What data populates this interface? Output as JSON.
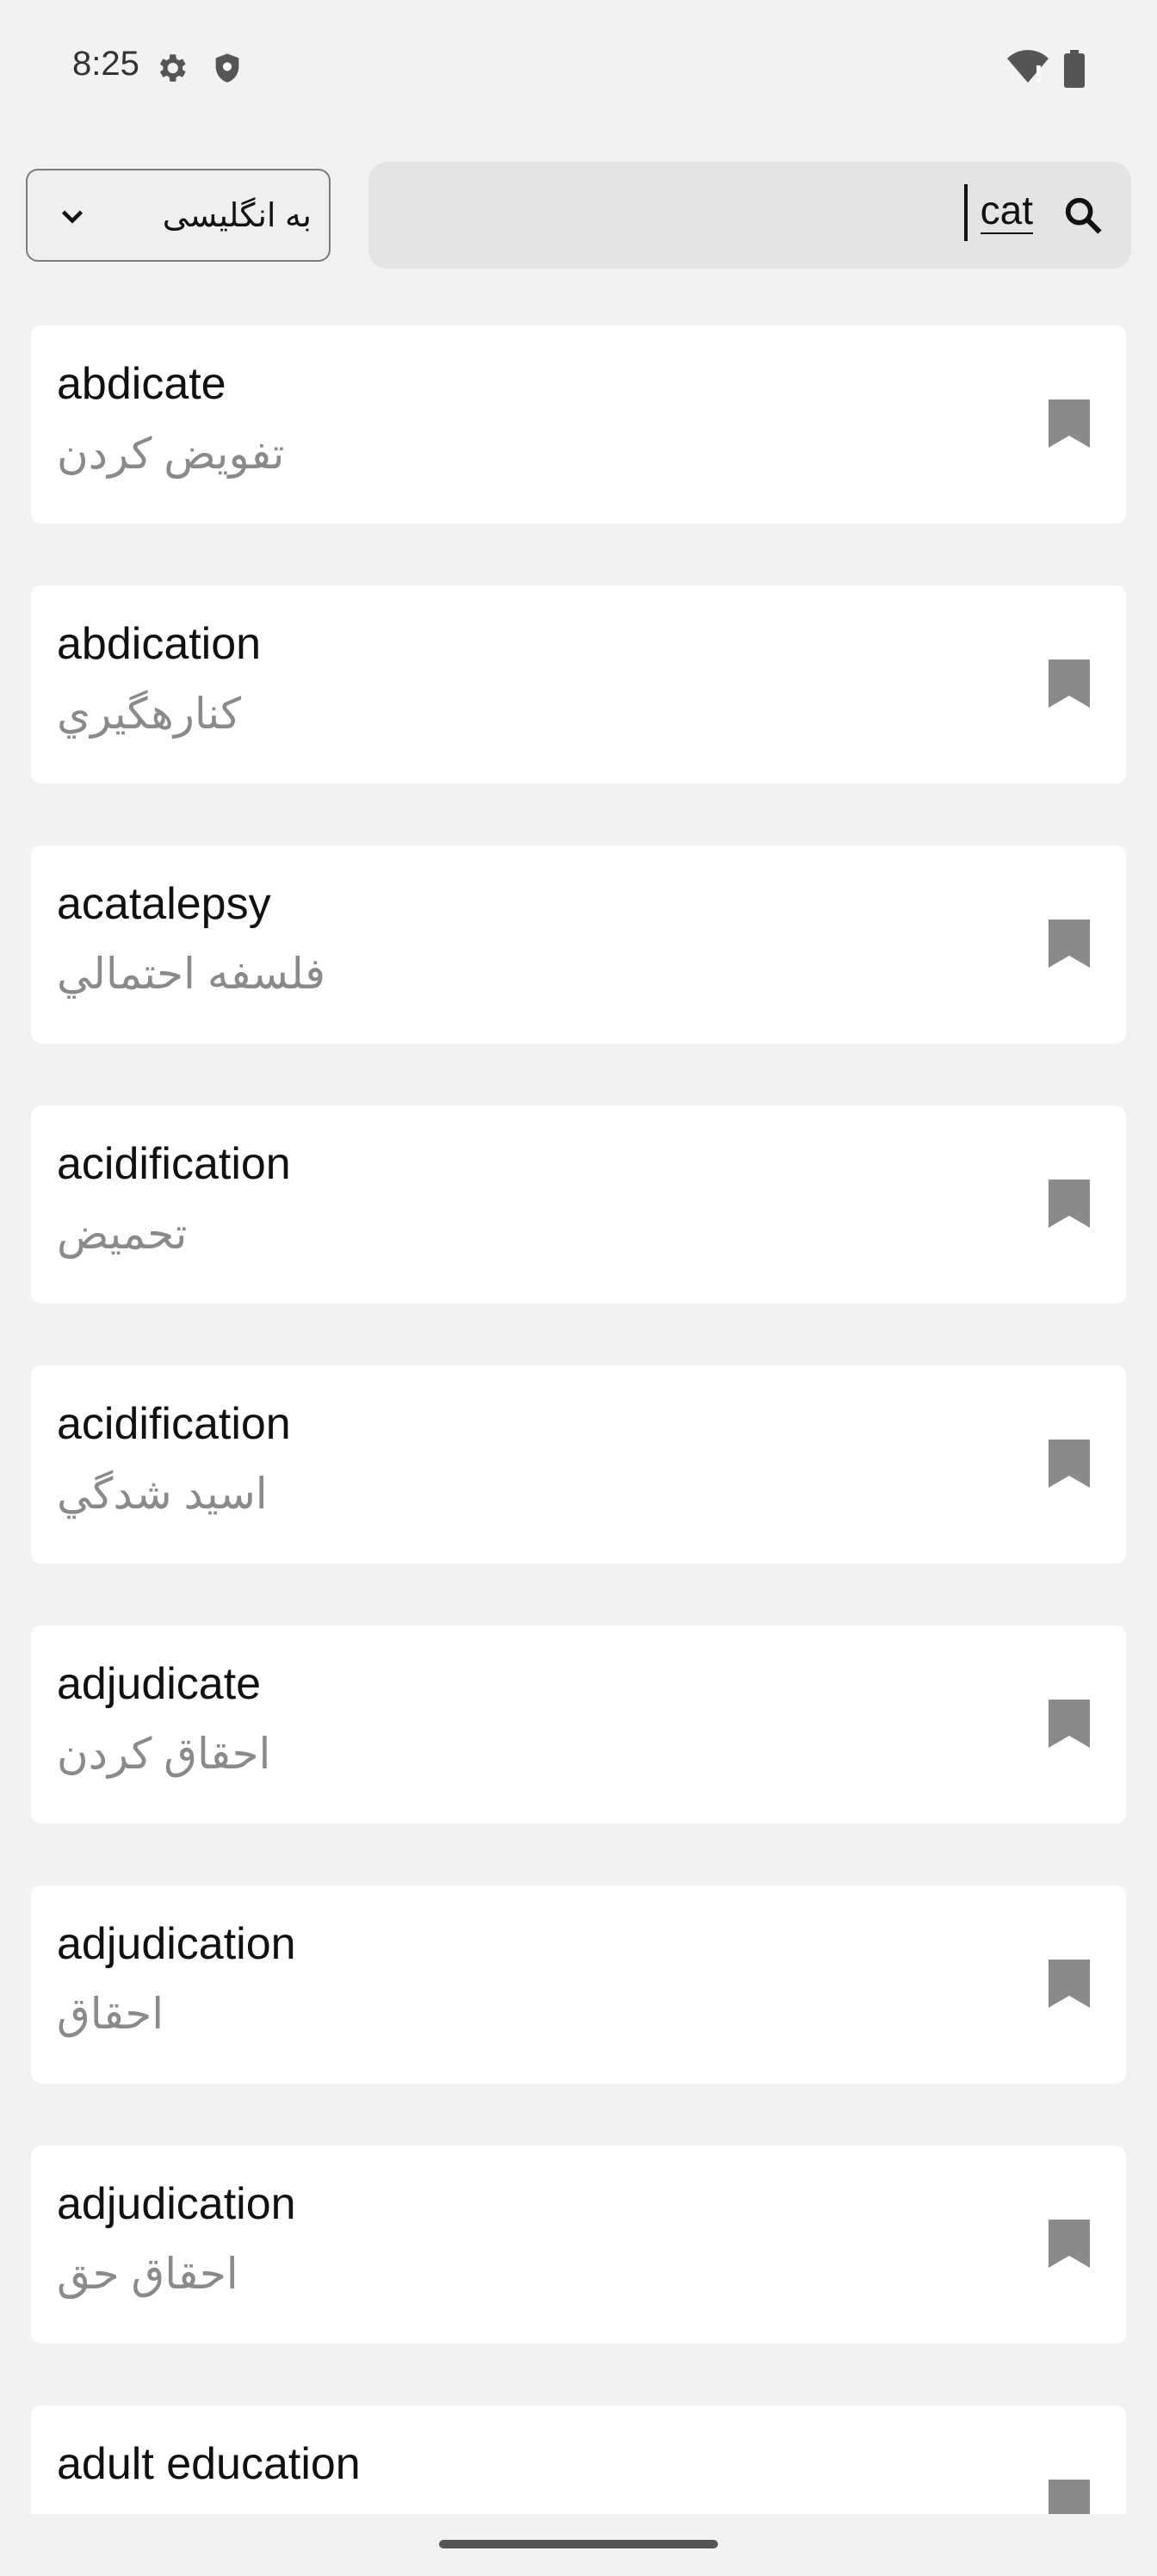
{
  "status_bar": {
    "time": "8:25",
    "left_icons": [
      "settings-icon",
      "shield-icon"
    ],
    "right_icons": [
      "wifi-icon",
      "battery-icon"
    ]
  },
  "language_select": {
    "selected": "به انگلیسی",
    "icon": "chevron-down-icon"
  },
  "search": {
    "value": "cat",
    "icon": "search-icon"
  },
  "results": [
    {
      "word": "abdicate",
      "meaning": "تفويض كردن"
    },
    {
      "word": "abdication",
      "meaning": "كنارهگيري"
    },
    {
      "word": "acatalepsy",
      "meaning": "فلسفه احتمالي"
    },
    {
      "word": "acidification",
      "meaning": "تحميض"
    },
    {
      "word": "acidification",
      "meaning": "اسيد شدگي"
    },
    {
      "word": "adjudicate",
      "meaning": "احقاق كردن"
    },
    {
      "word": "adjudication",
      "meaning": "احقاق"
    },
    {
      "word": "adjudication",
      "meaning": "احقاق حق"
    },
    {
      "word": "adult education",
      "meaning": ""
    }
  ],
  "colors": {
    "background": "#f2f2f2",
    "card": "#ffffff",
    "search_bg": "#e4e4e4",
    "meaning_text": "#8a8a8a",
    "bookmark": "#8a8a8a"
  }
}
